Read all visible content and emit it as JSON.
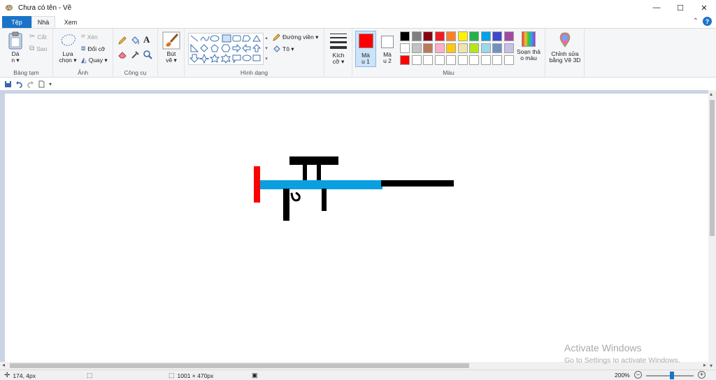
{
  "window": {
    "title": "Chưa có tên - Vẽ",
    "minimize": "—",
    "maximize": "☐",
    "close": "✕"
  },
  "tabs": {
    "file": "Tệp",
    "home": "Nhà",
    "view": "Xem",
    "collapse": "⌃",
    "help": "?"
  },
  "ribbon": {
    "clipboard": {
      "label": "Bảng tạm",
      "paste": "Dá\nn ▾",
      "cut": "Cắt",
      "copy": "Sao"
    },
    "image": {
      "label": "Ảnh",
      "select": "Lựa\nchọn ▾",
      "crop": "Xén",
      "resize": "Đổi cỡ",
      "rotate": "Quay ▾"
    },
    "tools": {
      "label": "Công cụ",
      "text_glyph": "A"
    },
    "brushes": {
      "label": "Bút\nvẽ ▾"
    },
    "shapes": {
      "label": "Hình dạng",
      "outline": "Đường viền ▾",
      "fill": "Tô ▾"
    },
    "size": {
      "label": "Kích\ncỡ ▾"
    },
    "colors": {
      "label": "Màu",
      "color1": "Mà\nu 1",
      "color2": "Mà\nu 2",
      "color1_value": "#ff0000",
      "color2_value": "#ffffff",
      "edit_colors": "Soạn thả\no màu",
      "palette_row1": [
        "#000000",
        "#7f7f7f",
        "#880015",
        "#ed1c24",
        "#ff7f27",
        "#fff200",
        "#22b14c",
        "#00a2e8",
        "#3f48cc",
        "#a349a4"
      ],
      "palette_row2": [
        "#ffffff",
        "#c3c3c3",
        "#b97a57",
        "#ffaec9",
        "#ffc90e",
        "#efe4b0",
        "#b5e61d",
        "#99d9ea",
        "#7092be",
        "#c8bfe7"
      ],
      "palette_row3": [
        "#ff0000",
        "#ffffff",
        "#ffffff",
        "#ffffff",
        "#ffffff",
        "#ffffff",
        "#ffffff",
        "#ffffff",
        "#ffffff",
        "#ffffff"
      ]
    },
    "paint3d": {
      "label": "Chỉnh sửa\nbằng Vẽ 3D"
    }
  },
  "qat": {
    "customize": "▾"
  },
  "watermark": {
    "line1": "Activate Windows",
    "line2": "Go to Settings to activate Windows."
  },
  "status": {
    "cursor": "174, 4px",
    "size": "1001 × 470px",
    "zoom": "200%",
    "zoom_out": "−",
    "zoom_in": "+"
  },
  "drawing_colors": {
    "blue": "#0aa0e0",
    "red": "#ff0000",
    "black": "#000000"
  }
}
